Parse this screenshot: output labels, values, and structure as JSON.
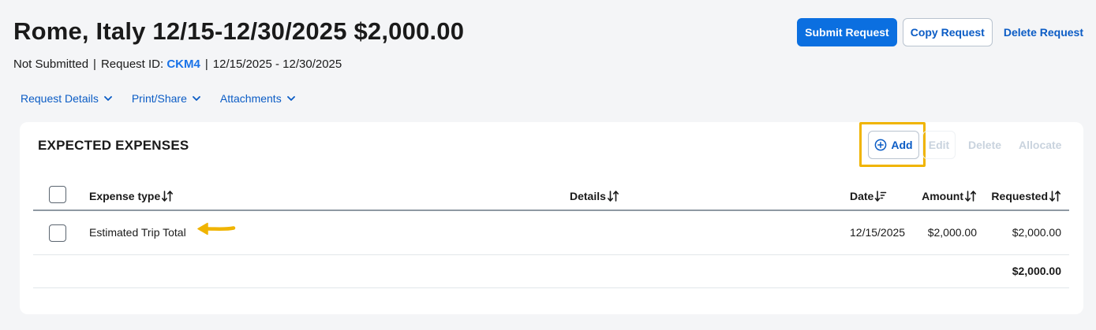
{
  "header": {
    "title": "Rome, Italy 12/15-12/30/2025 $2,000.00",
    "status": "Not Submitted",
    "separator": "|",
    "request_id_label": "Request ID:",
    "request_id": "CKM4",
    "date_range": "12/15/2025 - 12/30/2025"
  },
  "actions": {
    "submit": "Submit Request",
    "copy": "Copy Request",
    "delete": "Delete Request"
  },
  "subnav": {
    "items": [
      {
        "label": "Request Details"
      },
      {
        "label": "Print/Share"
      },
      {
        "label": "Attachments"
      }
    ]
  },
  "expenses": {
    "title": "EXPECTED EXPENSES",
    "toolbar": {
      "add": "Add",
      "edit": "Edit",
      "delete": "Delete",
      "allocate": "Allocate"
    },
    "columns": {
      "expense_type": "Expense type",
      "details": "Details",
      "date": "Date",
      "amount": "Amount",
      "requested": "Requested"
    },
    "rows": [
      {
        "expense_type": "Estimated Trip Total",
        "details": "",
        "date": "12/15/2025",
        "amount": "$2,000.00",
        "requested": "$2,000.00"
      }
    ],
    "total_requested": "$2,000.00"
  },
  "colors": {
    "accent": "#0b6fe0",
    "link": "#0b5cc5",
    "highlight": "#f0b400",
    "page_bg": "#f4f5f7"
  },
  "icons": {
    "add": "plus-circle-icon",
    "sort": "sort-arrows-icon",
    "sort_desc": "sort-descending-icon",
    "dropdown": "chevron-down-icon",
    "annotation": "pointer-arrow-icon"
  }
}
